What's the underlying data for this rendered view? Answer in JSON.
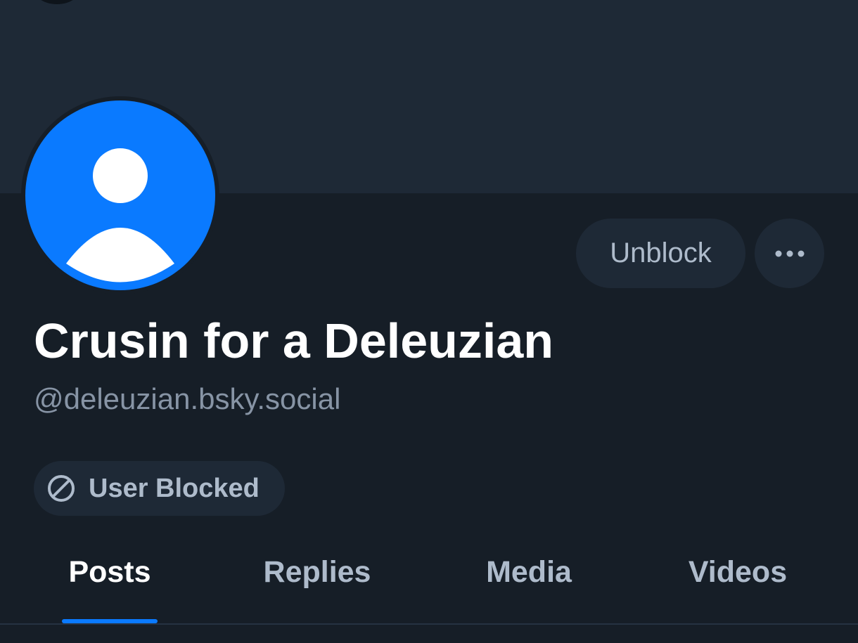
{
  "profile": {
    "display_name": "Crusin for a Deleuzian",
    "handle": "@deleuzian.bsky.social",
    "avatar_icon": "default-user-avatar-icon"
  },
  "actions": {
    "unblock_label": "Unblock",
    "more_icon": "ellipsis-icon"
  },
  "status_badge": {
    "icon": "blocked-circle-icon",
    "label": "User Blocked"
  },
  "tabs": [
    {
      "label": "Posts",
      "active": true
    },
    {
      "label": "Replies",
      "active": false
    },
    {
      "label": "Media",
      "active": false
    },
    {
      "label": "Videos",
      "active": false
    }
  ],
  "colors": {
    "accent": "#0a7aff",
    "background": "#161e27",
    "banner": "#1e2936",
    "muted_text": "#aebbcb",
    "handle_text": "#8794a5"
  }
}
